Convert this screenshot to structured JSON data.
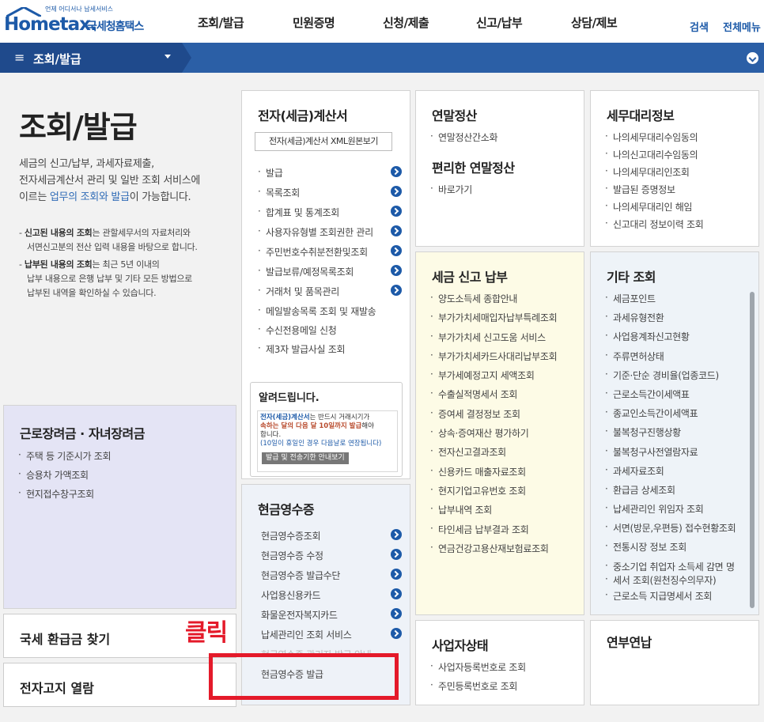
{
  "header": {
    "logo_main": "Hometax.",
    "logo_sub": "국세청홈택스",
    "logo_tiny": "언제 어디서나 납세서비스",
    "nav": [
      "조회/발급",
      "민원증명",
      "신청/제출",
      "신고/납부",
      "상담/제보"
    ],
    "search": "검색",
    "all_menu": "전체메뉴"
  },
  "bar": {
    "title": "조회/발급"
  },
  "intro": {
    "title": "조회/발급",
    "desc1": "세금의 신고/납부, 과세자료제출,",
    "desc2": "전자세금계산서 관리 및 일반 조회 서비스에",
    "desc3a": "이르는 ",
    "desc3b": "업무의 조회와 발급",
    "desc3c": "이 가능합니다.",
    "note1a": "신고된 내용의 조회",
    "note1b": "는 관할세무서의 자료처리와",
    "note1c": "서면신고분의 전산 입력 내용을 바탕으로 합니다.",
    "note2a": "납부된 내용의 조회",
    "note2b": "는 최근 5년 이내의",
    "note2c": "납부 내용으로 은행 납부 및 기타 모든 방법으로",
    "note2d": "납부된 내역을 확인하실 수 있습니다."
  },
  "etax": {
    "title": "전자(세금)계산서",
    "xml_btn": "전자(세금)계산서 XML원본보기",
    "items": [
      "발급",
      "목록조회",
      "합계표 및 통계조회",
      "사용자유형별 조회권한 관리",
      "주민번호수취분전환및조회",
      "발급보류/예정목록조회",
      "거래처 및 품목관리",
      "메일발송목록 조회 및 재발송",
      "수신전용메일 신청",
      "제3자 발급사실 조회"
    ],
    "notice_title": "알려드립니다.",
    "notice_l1a": "전자(세금)계산서",
    "notice_l1b": "는 반드시 거래시기가",
    "notice_l2a": "속하는 달의 다음 달 10일까지 발급",
    "notice_l2b": "해야",
    "notice_l3": "합니다.",
    "notice_l4": "(10일이 휴일인 경우 다음날로 연장됩니다)",
    "notice_btn": "발급 및 전송기한 안내보기"
  },
  "yearend": {
    "title1": "연말정산",
    "items1": [
      "연말정산간소화"
    ],
    "title2": "편리한 연말정산",
    "items2": [
      "바로가기"
    ]
  },
  "agent": {
    "title": "세무대리정보",
    "items": [
      "나의세무대리수임동의",
      "나의신고대리수임동의",
      "나의세무대리인조회",
      "발급된 증명정보",
      "나의세무대리인 해임",
      "신고대리 정보이력 조회"
    ]
  },
  "report": {
    "title": "세금 신고 납부",
    "items": [
      "양도소득세 종합안내",
      "부가가치세매입자납부특례조회",
      "부가가치세 신고도움 서비스",
      "부가가치세카드사대리납부조회",
      "부가세예정고지 세액조회",
      "수출실적명세서 조회",
      "증여세 결정정보 조회",
      "상속·증여재산 평가하기",
      "전자신고결과조회",
      "신용카드 매출자료조회",
      "현지기업고유번호 조회",
      "납부내역 조회",
      "타인세금 납부결과 조회",
      "연금건강고용산재보험료조회"
    ]
  },
  "other": {
    "title": "기타 조회",
    "items": [
      "세금포인트",
      "과세유형전환",
      "사업용계좌신고현황",
      "주류면허상태",
      "기준·단순 경비율(업종코드)",
      "근로소득간이세액표",
      "종교인소득간이세액표",
      "불복청구진행상황",
      "불복청구사전열람자료",
      "과세자료조회",
      "환급금 상세조회",
      "납세관리인 위임자 조회",
      "서면(방문,우편등) 접수현황조회",
      "전통시장 정보 조회",
      "중소기업 취업자 소득세 감면 명",
      "세서 조회(원천징수의무자)",
      "근로소득 지급명세서 조회"
    ]
  },
  "earned": {
    "title": "근로장려금 · 자녀장려금",
    "items": [
      "주택 등 기준시가 조회",
      "승용차 가액조회",
      "현지접수창구조회"
    ]
  },
  "cash": {
    "title": "현금영수증",
    "items": [
      "현금영수증조회",
      "현금영수증 수정",
      "현금영수증 발급수단",
      "사업용신용카드",
      "화물운전자복지카드",
      "납세관리인 조회 서비스",
      "현금영수증 관리자 발급 안내",
      "현금영수증 발급"
    ]
  },
  "biz": {
    "title": "사업자상태",
    "items": [
      "사업자등록번호로 조회",
      "주민등록번호로 조회"
    ]
  },
  "annual": {
    "title": "연부연납"
  },
  "refund": {
    "title": "국세 환급금 찾기"
  },
  "ebill": {
    "title": "전자고지 열람"
  },
  "annotation": {
    "click": "클릭"
  }
}
